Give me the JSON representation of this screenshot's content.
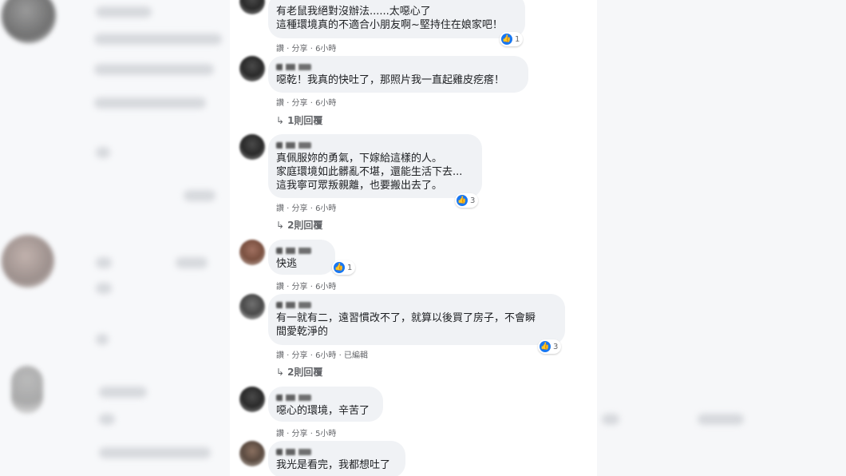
{
  "comments": [
    {
      "text": "有老鼠我絕對沒辦法......太噁心了\n這種環境真的不適合小朋友啊~堅持住在娘家吧！",
      "meta": "讚 · 分享 · 6小時",
      "reactions": "1"
    },
    {
      "text": "噁乾！我真的快吐了，那照片我一直起雞皮疙瘩！",
      "meta": "讚 · 分享 · 6小時",
      "replies": "1則回覆"
    },
    {
      "text": "真佩服妳的勇氣，下嫁給這樣的人。\n家庭環境如此髒亂不堪，還能生活下去...\n這我寧可眾叛親離，也要搬出去了。",
      "meta": "讚 · 分享 · 6小時",
      "reactions": "3",
      "replies": "2則回覆"
    },
    {
      "text": "快逃",
      "meta": "讚 · 分享 · 6小時",
      "reactions": "1"
    },
    {
      "text": "有一就有二，遠習慣改不了，就算以後買了房子，不會瞬\n間愛乾淨的",
      "meta": "讚 · 分享 · 6小時 · 已編輯",
      "reactions": "3",
      "replies": "2則回覆"
    },
    {
      "text": "噁心的環境，辛苦了",
      "meta": "讚 · 分享 · 5小時"
    },
    {
      "text": "我光是看完，我都想吐了"
    }
  ],
  "icons": {
    "like": "thumbs-up-icon",
    "reply": "reply-arrow-icon"
  },
  "colors": {
    "like_blue": "#1877f2",
    "bubble_bg": "#f0f2f5",
    "meta_text": "#65676b"
  }
}
